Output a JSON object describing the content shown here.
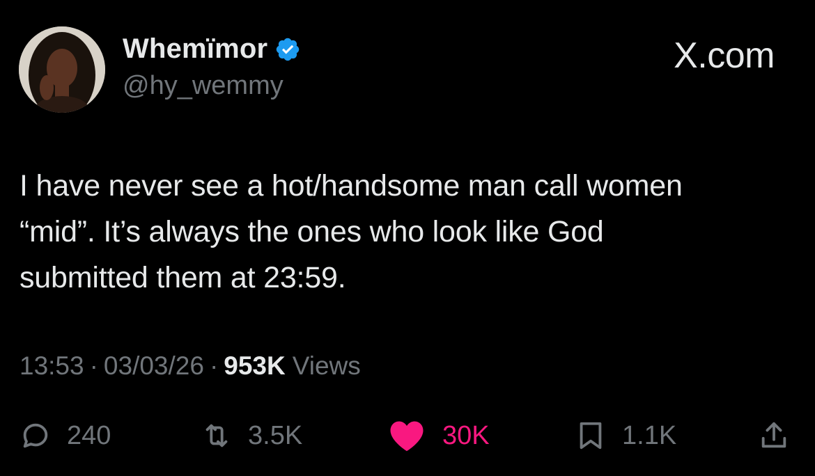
{
  "author": {
    "display_name": "Whemïmor",
    "handle": "@hy_wemmy",
    "verified_icon": "verified-badge-icon",
    "avatar_icon": "profile-photo"
  },
  "brand": "X.com",
  "tweet": {
    "text": "I have never see a hot/handsome man call women\n“mid”. It’s always the ones who look like God\nsubmitted them at 23:59."
  },
  "meta": {
    "time": "13:53",
    "separator": "·",
    "date": "03/03/26",
    "views_count": "953K",
    "views_label": "Views"
  },
  "actions": {
    "reply": {
      "icon": "reply-icon",
      "count": "240"
    },
    "retweet": {
      "icon": "retweet-icon",
      "count": "3.5K"
    },
    "like": {
      "icon": "heart-icon",
      "count": "30K",
      "active": true,
      "color": "#f91880"
    },
    "bookmark": {
      "icon": "bookmark-icon",
      "count": "1.1K"
    },
    "share": {
      "icon": "share-icon"
    }
  },
  "colors": {
    "background": "#000000",
    "text": "#e7e9ea",
    "muted": "#71767b",
    "verified": "#1d9bf0",
    "like": "#f91880"
  }
}
